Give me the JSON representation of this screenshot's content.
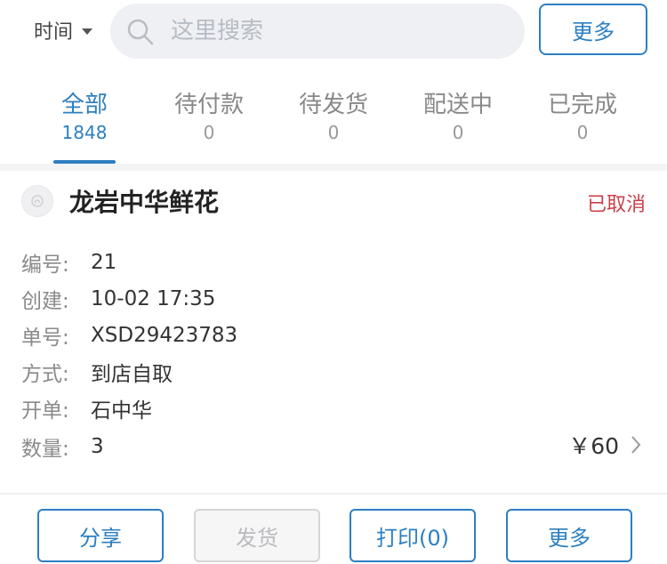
{
  "header": {
    "filter_label": "时间",
    "search_placeholder": "这里搜索",
    "more_label": "更多"
  },
  "tabs": [
    {
      "label": "全部",
      "count": "1848",
      "active": true
    },
    {
      "label": "待付款",
      "count": "0"
    },
    {
      "label": "待发货",
      "count": "0"
    },
    {
      "label": "配送中",
      "count": "0"
    },
    {
      "label": "已完成",
      "count": "0"
    }
  ],
  "order": {
    "shop_name": "龙岩中华鲜花",
    "status": "已取消",
    "fields": [
      {
        "key": "编号:",
        "value": "21"
      },
      {
        "key": "创建:",
        "value": "10-02 17:35"
      },
      {
        "key": "单号:",
        "value": "XSD29423783"
      },
      {
        "key": "方式:",
        "value": "到店自取"
      },
      {
        "key": "开单:",
        "value": "石中华"
      },
      {
        "key": "数量:",
        "value": "3"
      }
    ],
    "price": "￥60"
  },
  "actions": {
    "share": "分享",
    "ship": "发货",
    "print": "打印(0)",
    "more": "更多"
  },
  "colors": {
    "accent": "#2d7fc1",
    "status_cancelled": "#c8414b"
  }
}
